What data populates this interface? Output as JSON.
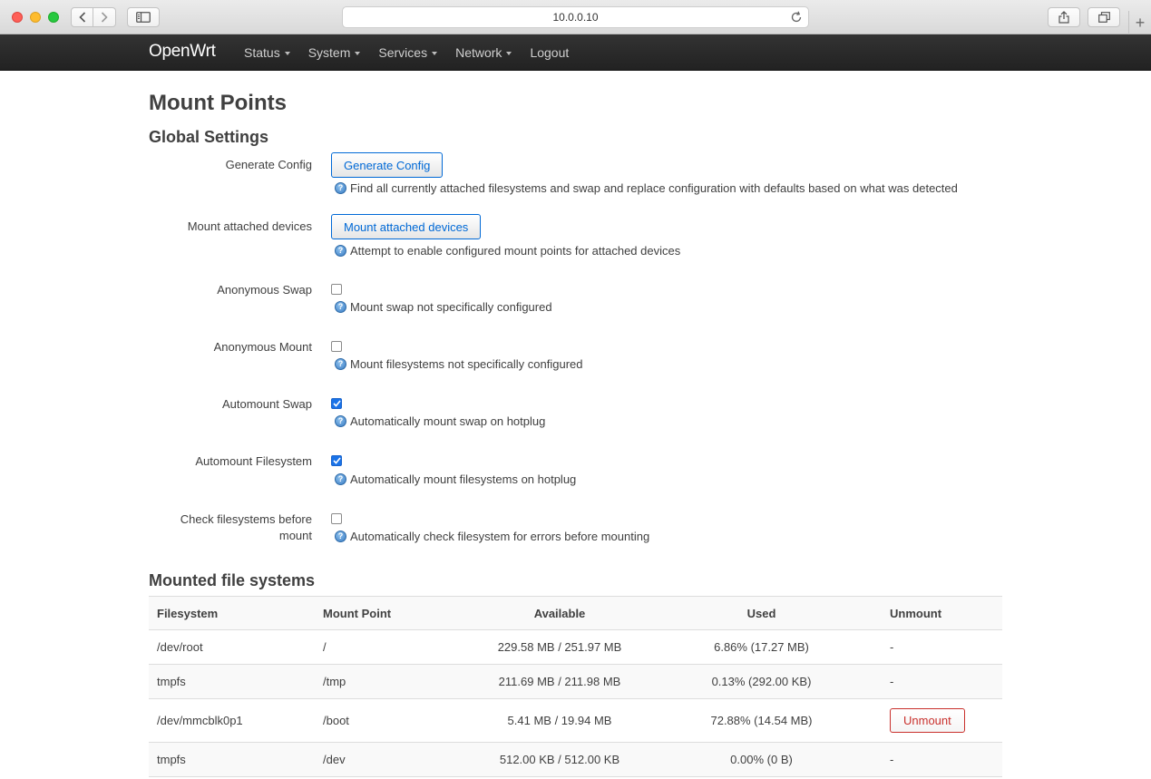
{
  "browser": {
    "url": "10.0.0.10"
  },
  "navbar": {
    "brand": "OpenWrt",
    "menu": [
      {
        "label": "Status",
        "dropdown": true
      },
      {
        "label": "System",
        "dropdown": true
      },
      {
        "label": "Services",
        "dropdown": true
      },
      {
        "label": "Network",
        "dropdown": true
      },
      {
        "label": "Logout",
        "dropdown": false
      }
    ]
  },
  "page": {
    "title": "Mount Points",
    "global_settings_title": "Global Settings",
    "mounted_title": "Mounted file systems"
  },
  "settings": {
    "generate_config": {
      "label": "Generate Config",
      "button": "Generate Config",
      "description": "Find all currently attached filesystems and swap and replace configuration with defaults based on what was detected"
    },
    "mount_attached": {
      "label": "Mount attached devices",
      "button": "Mount attached devices",
      "description": "Attempt to enable configured mount points for attached devices"
    },
    "anon_swap": {
      "label": "Anonymous Swap",
      "checked": false,
      "description": "Mount swap not specifically configured"
    },
    "anon_mount": {
      "label": "Anonymous Mount",
      "checked": false,
      "description": "Mount filesystems not specifically configured"
    },
    "automount_swap": {
      "label": "Automount Swap",
      "checked": true,
      "description": "Automatically mount swap on hotplug"
    },
    "automount_fs": {
      "label": "Automount Filesystem",
      "checked": true,
      "description": "Automatically mount filesystems on hotplug"
    },
    "check_fs": {
      "label_line1": "Check filesystems before",
      "label_line2": "mount",
      "checked": false,
      "description": "Automatically check filesystem for errors before mounting"
    }
  },
  "table": {
    "headers": [
      "Filesystem",
      "Mount Point",
      "Available",
      "Used",
      "Unmount"
    ],
    "rows": [
      {
        "filesystem": "/dev/root",
        "mount_point": "/",
        "available": "229.58 MB / 251.97 MB",
        "used": "6.86% (17.27 MB)",
        "unmount": "-"
      },
      {
        "filesystem": "tmpfs",
        "mount_point": "/tmp",
        "available": "211.69 MB / 211.98 MB",
        "used": "0.13% (292.00 KB)",
        "unmount": "-"
      },
      {
        "filesystem": "/dev/mmcblk0p1",
        "mount_point": "/boot",
        "available": "5.41 MB / 19.94 MB",
        "used": "72.88% (14.54 MB)",
        "unmount": "Unmount"
      },
      {
        "filesystem": "tmpfs",
        "mount_point": "/dev",
        "available": "512.00 KB / 512.00 KB",
        "used": "0.00% (0 B)",
        "unmount": "-"
      }
    ]
  },
  "colors": {
    "navbar_bg": "#222222",
    "link_blue": "#0069d6",
    "danger_red": "#c9302c",
    "checkbox_blue": "#1a73e8"
  }
}
